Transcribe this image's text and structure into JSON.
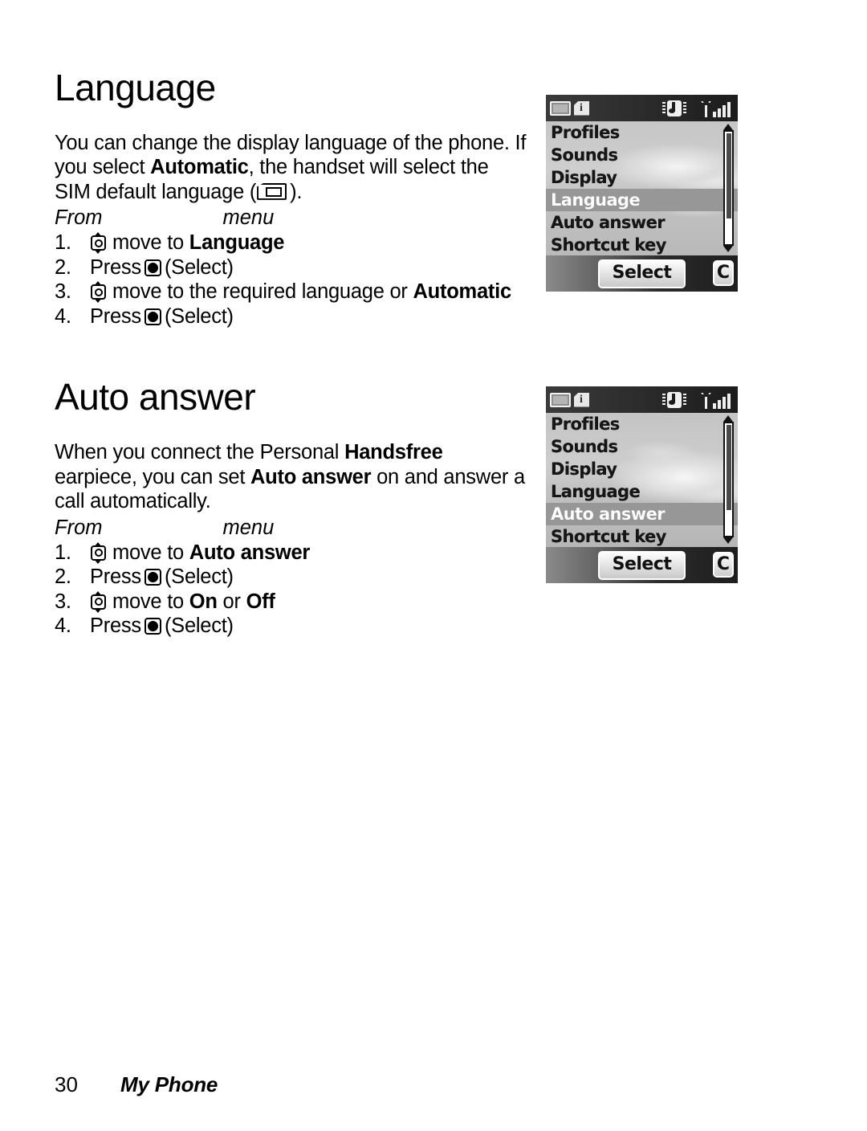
{
  "document": {
    "footer": {
      "page_number": "30",
      "chapter": "My Phone"
    }
  },
  "sections": [
    {
      "id": "language",
      "title": "Language",
      "paragraph": {
        "part1": "You can change the display language of the phone. If you select ",
        "bold1": "Automatic",
        "part2": ", the handset will select the SIM default language (",
        "sim_icon": "sim-card-icon",
        "part3": ").",
        "full_text": "You can change the display language of the phone. If you select Automatic, the handset will select the SIM default language ( )."
      },
      "from_line": {
        "from_word": "From",
        "menu_word": "menu"
      },
      "steps": [
        {
          "num": "1.",
          "lead_icon": "nav-key-icon",
          "text_before": "move to ",
          "bold": "Language",
          "text_after": ""
        },
        {
          "num": "2.",
          "text_before": "Press ",
          "inline_icon": "select-key-icon",
          "text_after": "(Select)"
        },
        {
          "num": "3.",
          "lead_icon": "nav-key-icon",
          "text_before": "move to the required language or ",
          "bold": "Automatic",
          "text_after": ""
        },
        {
          "num": "4.",
          "text_before": "Press ",
          "inline_icon": "select-key-icon",
          "text_after": "(Select)"
        }
      ]
    },
    {
      "id": "auto-answer",
      "title": "Auto answer",
      "paragraph": {
        "part1": "When you connect the Personal ",
        "bold1": "Handsfree",
        "part2": " earpiece, you can set ",
        "bold2": "Auto answer",
        "part3": " on and answer a call automatically.",
        "full_text": "When you connect the Personal Handsfree earpiece, you can set Auto answer on and answer a call automatically."
      },
      "from_line": {
        "from_word": "From",
        "menu_word": "menu"
      },
      "steps": [
        {
          "num": "1.",
          "lead_icon": "nav-key-icon",
          "text_before": "move to ",
          "bold": "Auto answer",
          "text_after": ""
        },
        {
          "num": "2.",
          "text_before": "Press ",
          "inline_icon": "select-key-icon",
          "text_after": "(Select)"
        },
        {
          "num": "3.",
          "lead_icon": "nav-key-icon",
          "text_before": "move to ",
          "bold": "On",
          "text_mid": " or ",
          "bold_b": "Off",
          "text_after": ""
        },
        {
          "num": "4.",
          "text_before": "Press ",
          "inline_icon": "select-key-icon",
          "text_after": "(Select)"
        }
      ]
    }
  ],
  "phone_screens": [
    {
      "id": "shot-language",
      "status_icons": [
        "battery-icon",
        "sim-info-icon",
        "ringer-icon",
        "signal-icon"
      ],
      "menu_items": [
        "Profiles",
        "Sounds",
        "Display",
        "Language",
        "Auto answer",
        "Shortcut key"
      ],
      "selected_item": "Language",
      "selected_index": 3,
      "softkey_left": "Select",
      "softkey_right": "C"
    },
    {
      "id": "shot-autoanswer",
      "status_icons": [
        "battery-icon",
        "sim-info-icon",
        "ringer-icon",
        "signal-icon"
      ],
      "menu_items": [
        "Profiles",
        "Sounds",
        "Display",
        "Language",
        "Auto answer",
        "Shortcut key"
      ],
      "selected_item": "Auto answer",
      "selected_index": 4,
      "softkey_left": "Select",
      "softkey_right": "C"
    }
  ],
  "colors": {
    "page_background": "#ffffff",
    "text": "#000000",
    "screen_background": "#c9c9c9",
    "menu_highlight": "#979797",
    "menu_highlight_text": "#ffffff",
    "status_bar": "#2d2d2d",
    "softkey_bar": "#3a3a3a"
  }
}
